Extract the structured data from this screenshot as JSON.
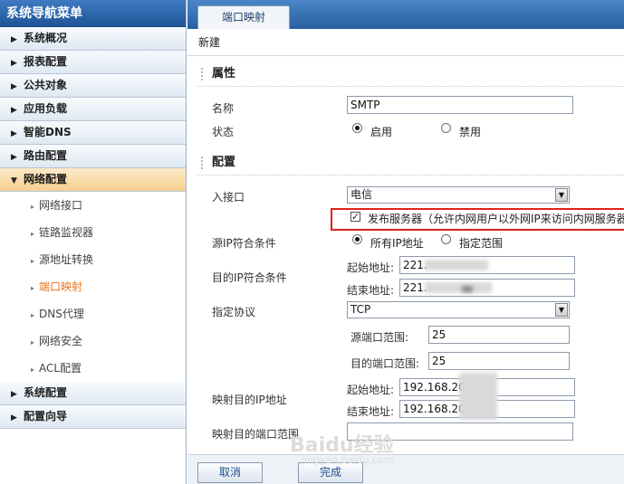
{
  "sidebar": {
    "title": "系统导航菜单",
    "groups_top": [
      {
        "label": "系统概况"
      },
      {
        "label": "报表配置"
      },
      {
        "label": "公共对象"
      },
      {
        "label": "应用负载"
      },
      {
        "label": "智能DNS"
      },
      {
        "label": "路由配置"
      }
    ],
    "open_group": {
      "label": "网络配置"
    },
    "subitems": [
      {
        "label": "网络接口"
      },
      {
        "label": "链路监视器"
      },
      {
        "label": "源地址转换"
      },
      {
        "label": "端口映射",
        "active": true
      },
      {
        "label": "DNS代理"
      },
      {
        "label": "网络安全"
      },
      {
        "label": "ACL配置"
      }
    ],
    "groups_bottom": [
      {
        "label": "系统配置"
      },
      {
        "label": "配置向导"
      }
    ]
  },
  "tab": {
    "label": "端口映射"
  },
  "toolbar": {
    "new_label": "新建"
  },
  "form": {
    "section_properties": "属性",
    "name_label": "名称",
    "name_value": "SMTP",
    "status_label": "状态",
    "status_enabled": "启用",
    "status_disabled": "禁用",
    "section_config": "配置",
    "ingress_label": "入接口",
    "ingress_value": "电信",
    "publish_label": "发布服务器（允许内网用户以外网IP来访问内网服务器",
    "src_ip_label": "源IP符合条件",
    "src_all": "所有IP地址",
    "src_range": "指定范围",
    "dst_ip_label": "目的IP符合条件",
    "dst_start_label": "起始地址:",
    "dst_start_value": "221.",
    "dst_end_label": "结束地址:",
    "dst_end_value": "221.",
    "protocol_label": "指定协议",
    "protocol_value": "TCP",
    "src_port_label": "源端口范围:",
    "src_port_value": "25",
    "dst_port_label": "目的端口范围:",
    "dst_port_value": "25",
    "map_ip_label": "映射目的IP地址",
    "map_start_label": "起始地址:",
    "map_start_value": "192.168.20",
    "map_end_label": "结束地址:",
    "map_end_value": "192.168.20",
    "map_port_label": "映射目的端口范围",
    "map_port_value": ""
  },
  "footer": {
    "cancel_label": "取消",
    "done_label": "完成"
  },
  "watermark": {
    "main": "Baidu经验",
    "sub": "jingyan.baidu.com"
  },
  "colors": {
    "nav_blue": "#285f9f",
    "active_orange": "#e8731c",
    "highlight_red": "#e0201d"
  }
}
